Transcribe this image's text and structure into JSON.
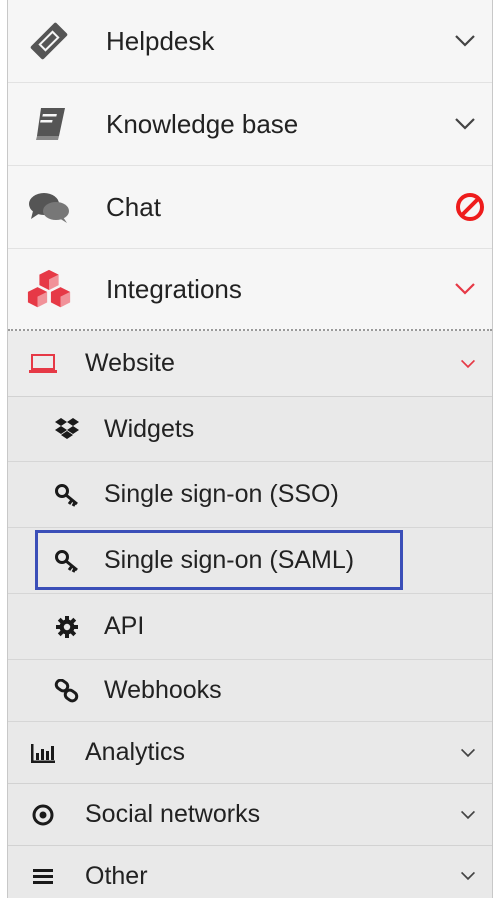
{
  "menu": {
    "main_items": [
      {
        "label": "Helpdesk",
        "icon": "ticket-icon",
        "state": "collapsed"
      },
      {
        "label": "Knowledge base",
        "icon": "book-icon",
        "state": "collapsed"
      },
      {
        "label": "Chat",
        "icon": "comments-icon",
        "state": "disabled"
      },
      {
        "label": "Integrations",
        "icon": "cubes-icon",
        "state": "expanded"
      }
    ],
    "website": {
      "label": "Website",
      "icon": "laptop-icon",
      "state": "expanded"
    },
    "website_items": [
      {
        "label": "Widgets",
        "icon": "dropbox-icon"
      },
      {
        "label": "Single sign-on (SSO)",
        "icon": "key-icon"
      },
      {
        "label": "Single sign-on (SAML)",
        "icon": "key-icon",
        "highlighted": true
      },
      {
        "label": "API",
        "icon": "gear-icon"
      },
      {
        "label": "Webhooks",
        "icon": "link-icon"
      }
    ],
    "sub_items": [
      {
        "label": "Analytics",
        "icon": "bar-chart-icon"
      },
      {
        "label": "Social networks",
        "icon": "target-icon"
      },
      {
        "label": "Other",
        "icon": "hamburger-icon"
      }
    ]
  },
  "colors": {
    "accent": "#e63946",
    "disabled": "#ee1c1c",
    "highlight": "#3b4fb8",
    "icon_gray": "#4a4a4a",
    "text": "#222222"
  }
}
